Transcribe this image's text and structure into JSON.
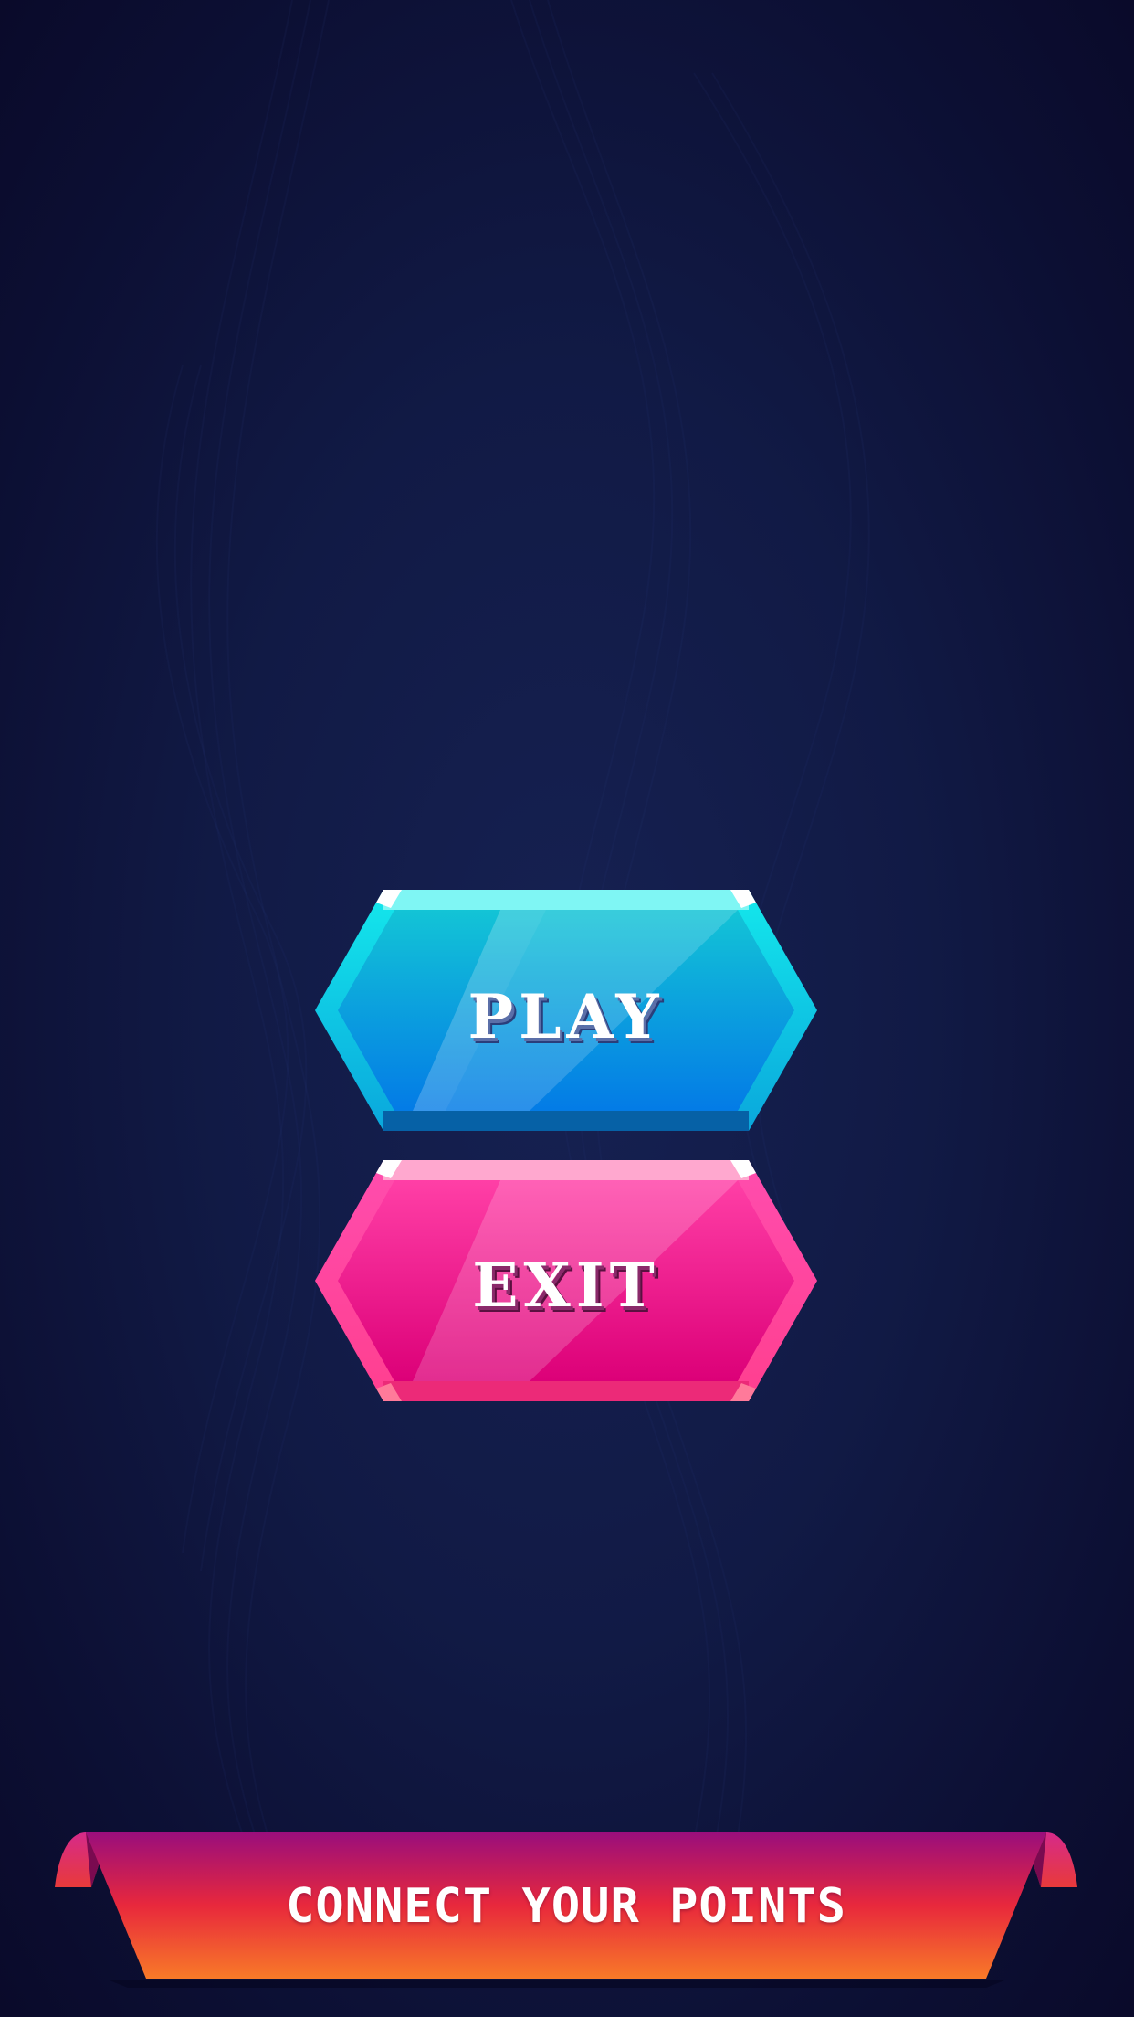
{
  "menu": {
    "play_label": "PLAY",
    "exit_label": "EXIT"
  },
  "banner": {
    "text": "CONNECT YOUR POINTS"
  },
  "colors": {
    "background": "#121a48",
    "play_primary": "#0bb8dc",
    "play_secondary": "#047be3",
    "exit_primary": "#ff3da3",
    "exit_secondary": "#e0007a",
    "banner_top": "#9c0f7a",
    "banner_bottom": "#f7772a"
  }
}
